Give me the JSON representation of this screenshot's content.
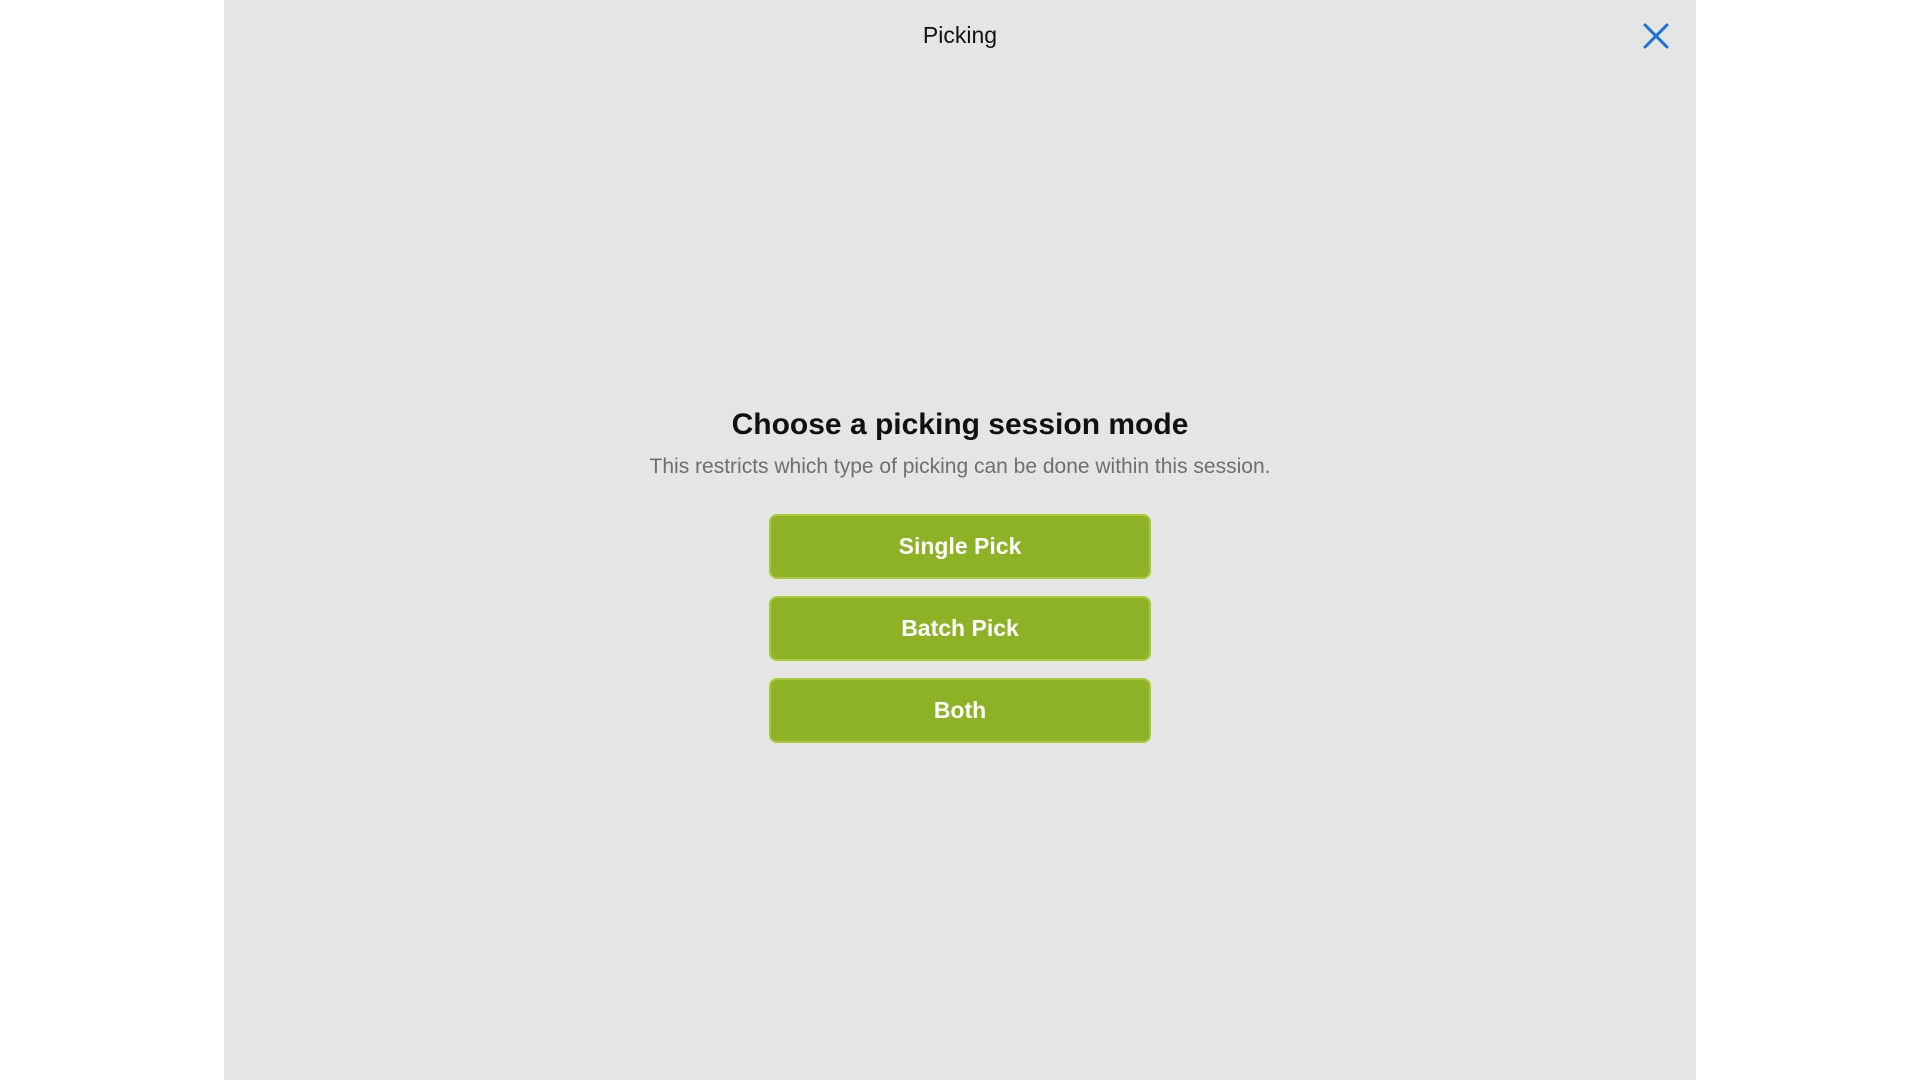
{
  "header": {
    "title": "Picking",
    "close_icon": "close-icon",
    "accent_color": "#1a73d9"
  },
  "main": {
    "heading": "Choose a picking session mode",
    "subtitle": "This restricts which type of picking can be done within this session.",
    "buttons": [
      {
        "label": "Single Pick"
      },
      {
        "label": "Batch Pick"
      },
      {
        "label": "Both"
      }
    ],
    "button_color": "#8eb226",
    "background_color": "#e5e5e5"
  }
}
